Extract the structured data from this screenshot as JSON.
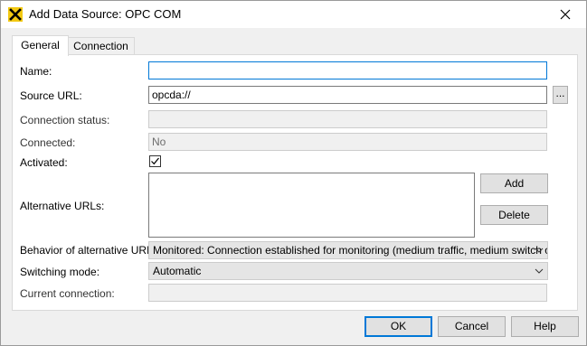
{
  "window": {
    "title": "Add Data Source: OPC COM"
  },
  "tabs": [
    {
      "label": "General",
      "active": true
    },
    {
      "label": "Connection",
      "active": false
    }
  ],
  "form": {
    "name": {
      "label": "Name:",
      "value": ""
    },
    "source_url": {
      "label": "Source URL:",
      "value": "opcda://",
      "browse_label": "..."
    },
    "connection_status": {
      "label": "Connection status:",
      "value": ""
    },
    "connected": {
      "label": "Connected:",
      "value": "No"
    },
    "activated": {
      "label": "Activated:",
      "checked": true
    },
    "alternative_urls": {
      "label": "Alternative URLs:",
      "items": [],
      "add_label": "Add",
      "delete_label": "Delete"
    },
    "behavior": {
      "label": "Behavior of alternative URLs:",
      "value": "Monitored: Connection established for monitoring (medium traffic, medium switch over)"
    },
    "switching_mode": {
      "label": "Switching mode:",
      "value": "Automatic"
    },
    "current_connection": {
      "label": "Current connection:",
      "value": ""
    }
  },
  "footer": {
    "ok_label": "OK",
    "cancel_label": "Cancel",
    "help_label": "Help"
  },
  "colors": {
    "accent": "#0078d7",
    "icon_bg": "#f2c811"
  }
}
